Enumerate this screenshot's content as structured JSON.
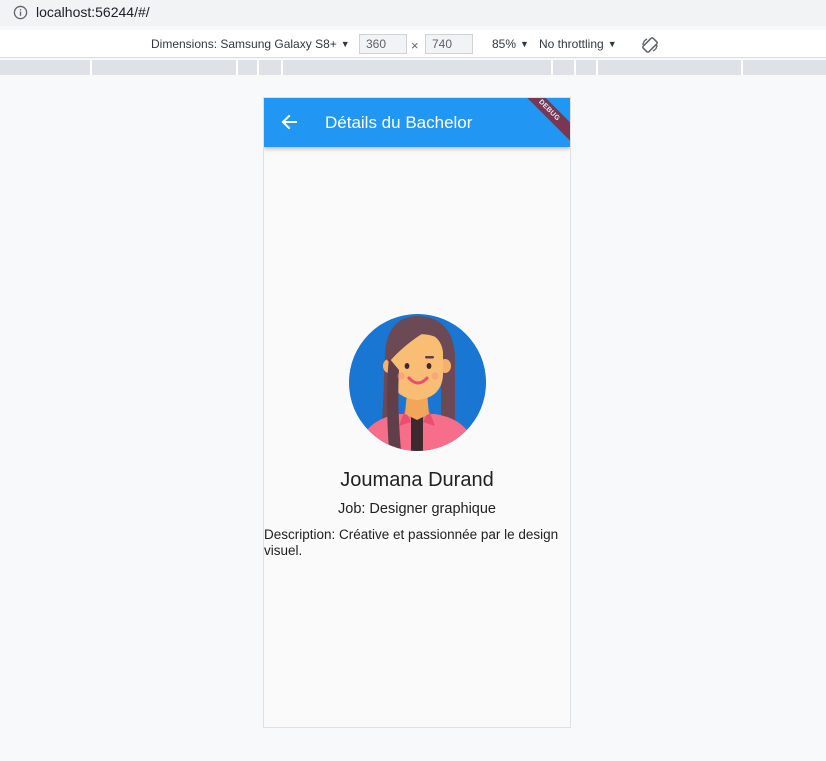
{
  "browser": {
    "url": "localhost:56244/#/"
  },
  "devtools": {
    "dimensions_label": "Dimensions: Samsung Galaxy S8+",
    "width": "360",
    "height": "740",
    "times": "×",
    "zoom": "85%",
    "throttling": "No throttling"
  },
  "app": {
    "title": "Détails du Bachelor",
    "debug_banner": "DEBUG",
    "name": "Joumana Durand",
    "job": "Job: Designer graphique",
    "description": "Description: Créative et passionnée par le design visuel."
  },
  "colors": {
    "appbar": "#2196f3",
    "avatar_bg": "#1976d2"
  }
}
